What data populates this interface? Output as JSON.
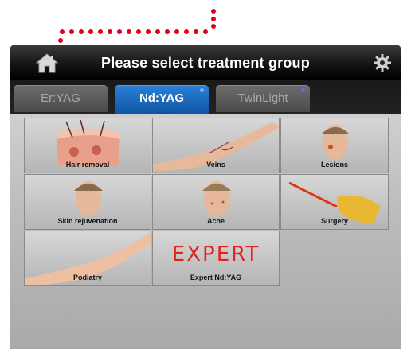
{
  "header": {
    "title": "Please select treatment group",
    "home_icon": "home-icon",
    "settings_icon": "gear-icon"
  },
  "tabs": [
    {
      "label": "Er:YAG",
      "active": false
    },
    {
      "label": "Nd:YAG",
      "active": true
    },
    {
      "label": "TwinLight",
      "active": false
    }
  ],
  "treatments": [
    {
      "label": "Hair removal"
    },
    {
      "label": "Veins"
    },
    {
      "label": "Lesions"
    },
    {
      "label": "Skin rejuvenation"
    },
    {
      "label": "Acne"
    },
    {
      "label": "Surgery"
    },
    {
      "label": "Podiatry"
    },
    {
      "label": "Expert Nd:YAG",
      "logo_text": "EXPERT"
    }
  ],
  "colors": {
    "annotation": "#e2001a",
    "active_tab": "#1466c0",
    "tab_dot": "#7a5cff"
  }
}
